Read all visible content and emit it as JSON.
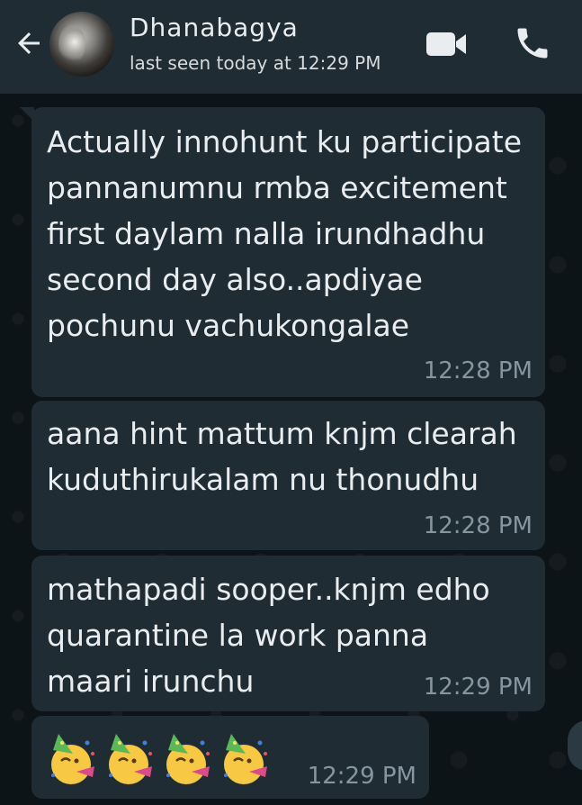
{
  "header": {
    "back_icon": "arrow-left-icon",
    "contact_name": "Dhanabagya",
    "status": "last seen today at 12:29 PM",
    "video_icon": "video-camera-icon",
    "call_icon": "phone-icon"
  },
  "messages": [
    {
      "text": "Actually innohunt ku participate pannanumnu rmba excitement first daylam nalla irundhadhu second day also..apdiyae pochunu vachukongalae",
      "time": "12:28 PM"
    },
    {
      "text": "aana hint mattum knjm clearah kuduthirukalam nu thonudhu",
      "time": "12:28 PM"
    },
    {
      "text": "mathapadi sooper..knjm edho quarantine la work panna maari irunchu",
      "time": "12:29 PM"
    },
    {
      "emoji": [
        "party-face-emoji",
        "party-face-emoji",
        "party-face-emoji",
        "party-face-emoji"
      ],
      "time": "12:29 PM"
    }
  ],
  "colors": {
    "header_bg": "#1f2c34",
    "chat_bg": "#0d1418",
    "bubble_bg": "#1f2c34",
    "text": "#e9edef",
    "time": "#8696a0"
  }
}
